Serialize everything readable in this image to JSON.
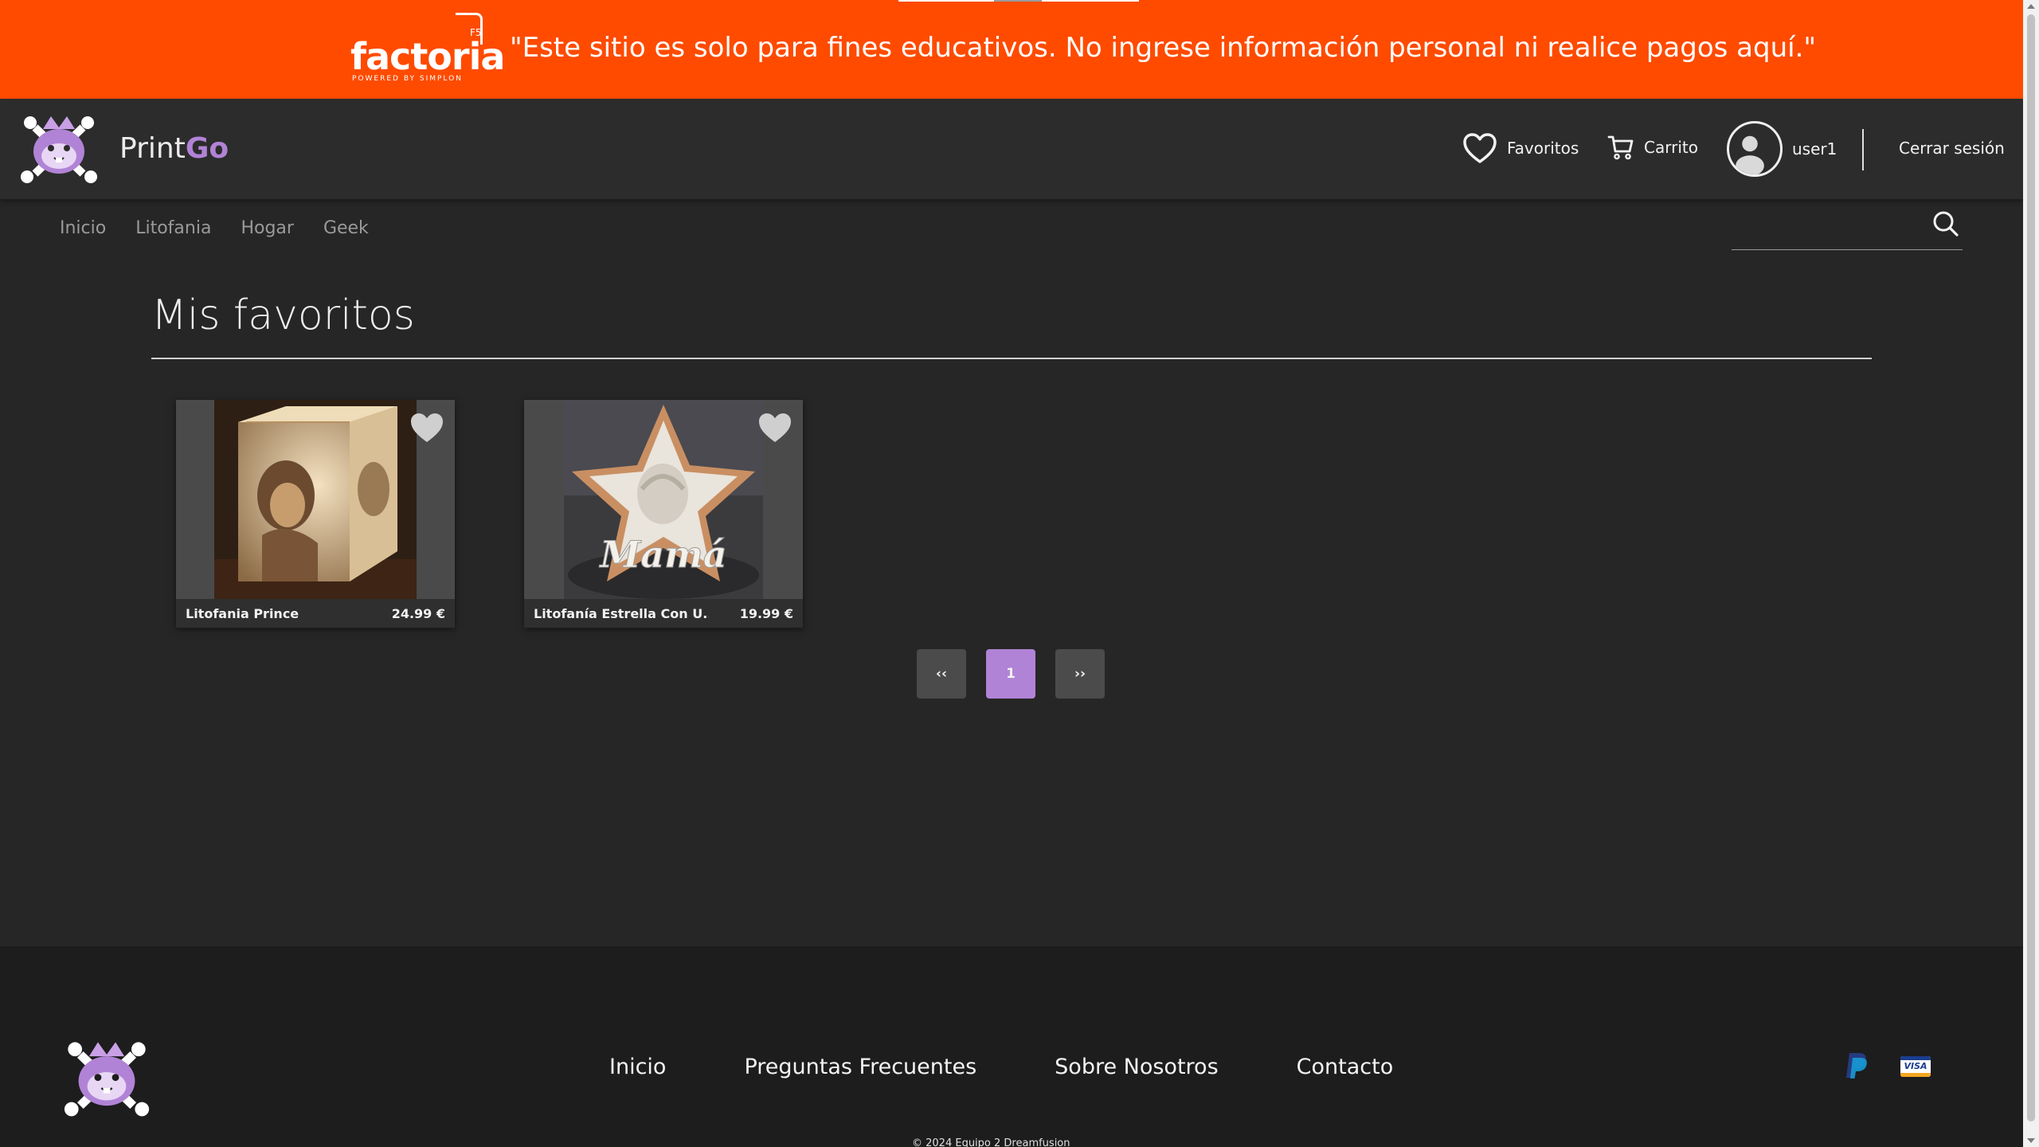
{
  "banner": {
    "logo_word": "factoria",
    "logo_sub": "POWERED BY SIMPLON",
    "logo_badge": "F5",
    "notice": "\"Este sitio es solo para fines educativos. No ingrese información personal ni realice pagos aquí.\"",
    "color": "#fe4b00"
  },
  "header": {
    "brand_prefix": "Print",
    "brand_suffix": "Go",
    "favorites_label": "Favoritos",
    "cart_label": "Carrito",
    "username": "user1",
    "logout_label": "Cerrar sesión",
    "icons": {
      "favorites": "heart-outline-icon",
      "cart": "cart-icon",
      "user": "user-avatar-icon"
    }
  },
  "nav": {
    "items": [
      "Inicio",
      "Litofania",
      "Hogar",
      "Geek"
    ],
    "search_placeholder": ""
  },
  "main": {
    "title": "Mis favoritos",
    "products": [
      {
        "name": "Litofania Prince",
        "price": "24.99 €",
        "image": "lithophane-cube-photo",
        "favorite_icon": "heart-icon"
      },
      {
        "name": "Litofanía Estrella Con U...",
        "price": "19.99 €",
        "image": "lithophane-star-photo",
        "favorite_icon": "heart-icon"
      }
    ],
    "pagination": {
      "prev": "‹‹",
      "current": "1",
      "next": "››"
    }
  },
  "footer": {
    "links": [
      "Inicio",
      "Preguntas Frecuentes",
      "Sobre Nosotros",
      "Contacto"
    ],
    "payments": [
      "paypal-icon",
      "visa-icon"
    ],
    "visa_text": "VISA",
    "copyright": "© 2024 Equipo 2 Dreamfusion"
  },
  "theme": {
    "accent": "#b183d6",
    "background": "#262626",
    "header_bg": "#2c2c2c",
    "footer_bg": "#1d1d1d"
  }
}
